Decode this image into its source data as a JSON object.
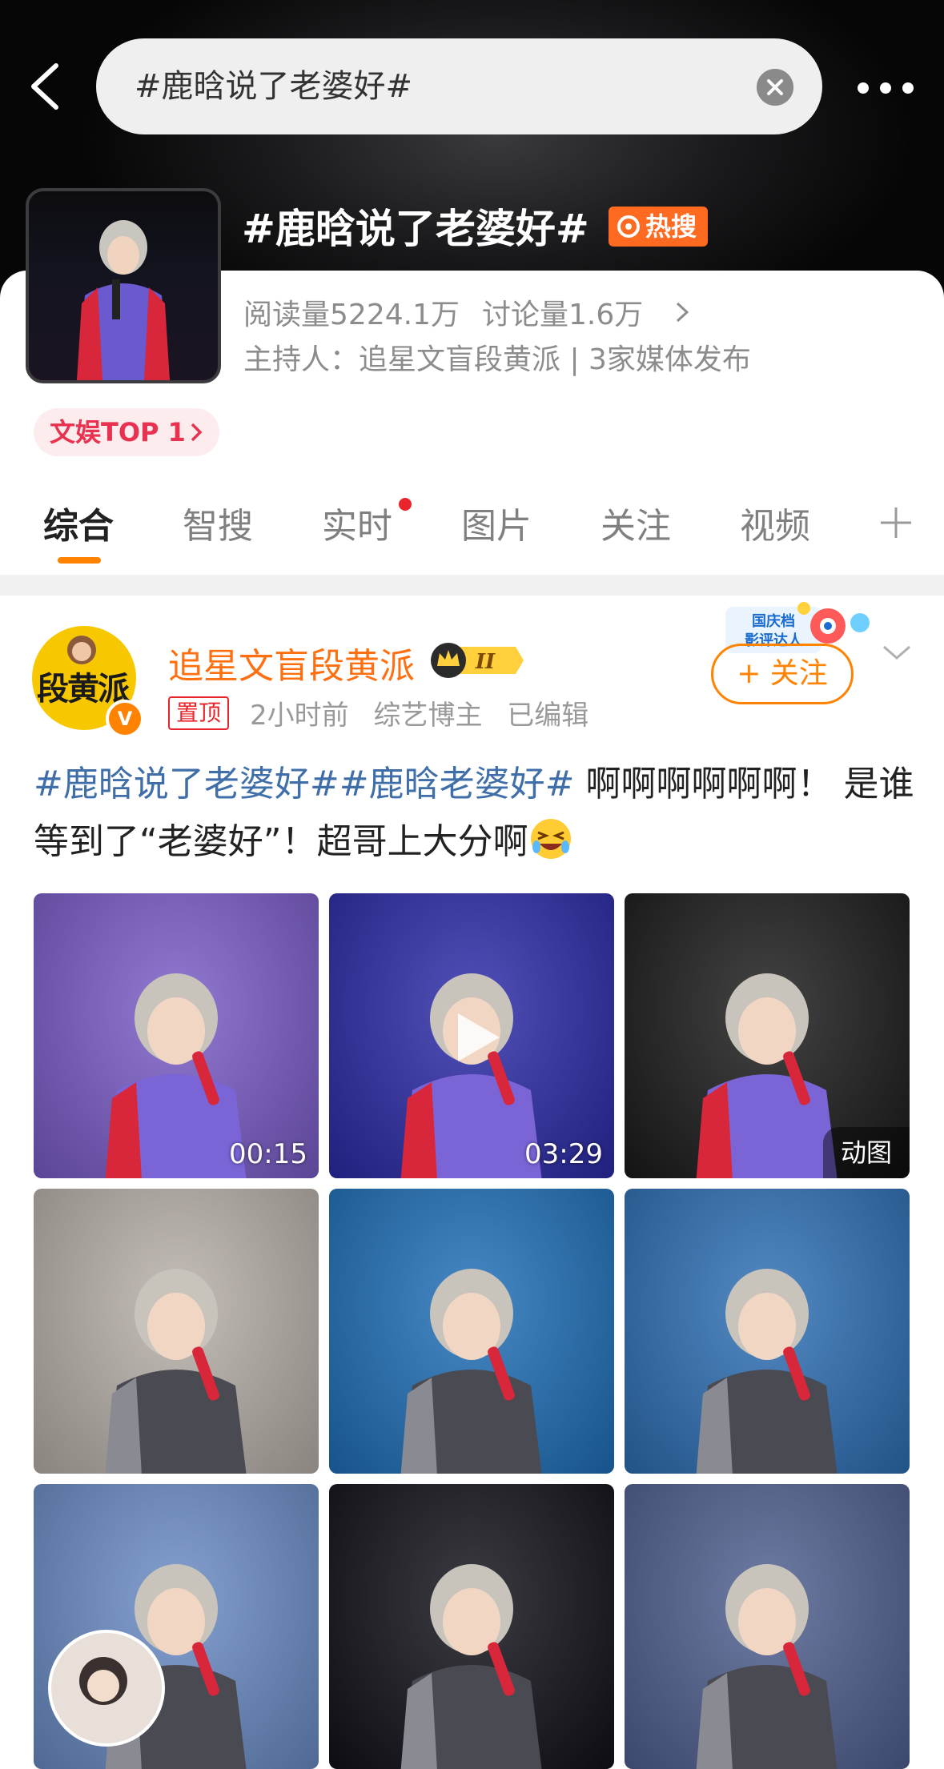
{
  "header": {
    "search_text": "#鹿晗说了老婆好#",
    "topic_title": "#鹿晗说了老婆好#",
    "hot_badge": "热搜"
  },
  "stats": {
    "reads_label": "阅读量",
    "reads_value": "5224.1万",
    "discuss_label": "讨论量",
    "discuss_value": "1.6万",
    "host_line": "主持人：追星文盲段黄派 | 3家媒体发布"
  },
  "rank_pill": "文娱TOP 1",
  "tabs": [
    {
      "label": "综合",
      "active": true
    },
    {
      "label": "智搜",
      "active": false
    },
    {
      "label": "实时",
      "active": false,
      "dot": true
    },
    {
      "label": "图片",
      "active": false
    },
    {
      "label": "关注",
      "active": false
    },
    {
      "label": "视频",
      "active": false
    }
  ],
  "post": {
    "avatar_text": "段黄派",
    "author": "追星文盲段黄派",
    "vip_level": "II",
    "pin_tag": "置顶",
    "time": "2小时前",
    "role": "综艺博主",
    "edited": "已编辑",
    "follow_label": "+ 关注",
    "holiday_badge_line1": "国庆档",
    "holiday_badge_line2": "影评达人",
    "text_tags": "#鹿晗说了老婆好##鹿晗老婆好#",
    "text_body_1": " 啊啊啊啊啊啊！ 是谁等到了“老婆好”！超哥上大分啊",
    "media": [
      {
        "kind": "video",
        "duration": "00:15",
        "bg": "#7a5cc8"
      },
      {
        "kind": "video",
        "duration": "03:29",
        "bg": "#2a2aa8"
      },
      {
        "kind": "gif",
        "tag": "动图",
        "bg": "#1a1a1a"
      },
      {
        "kind": "image",
        "bg": "#b8b0aa"
      },
      {
        "kind": "image",
        "bg": "#1e6fb8"
      },
      {
        "kind": "image",
        "bg": "#2d6fb5"
      },
      {
        "kind": "image",
        "bg": "#6a8cc6"
      },
      {
        "kind": "image",
        "bg": "#101018"
      },
      {
        "kind": "image",
        "bg": "#4f5f8f"
      }
    ]
  },
  "colors": {
    "brand_orange": "#ff8200",
    "hot_badge": "#ff6a21",
    "hashtag_blue": "#3f6ea9",
    "rank_red": "#e83250"
  }
}
